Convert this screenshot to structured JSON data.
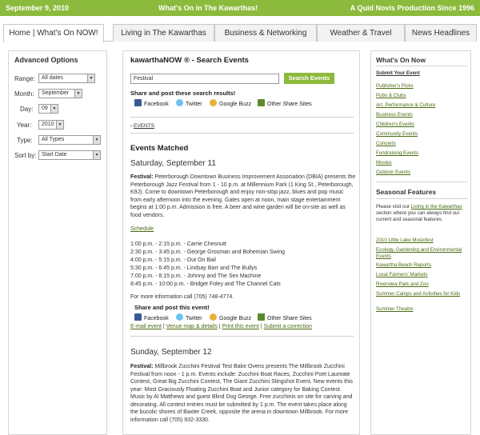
{
  "topbar": {
    "date": "September 9, 2010",
    "tagline": "What's On in The Kawarthas!",
    "production": "A Quid Novis Production Since 1996"
  },
  "nav": {
    "tabs": [
      {
        "label": "Home | What's On NOW!"
      },
      {
        "label": "Living in The Kawarthas"
      },
      {
        "label": "Business & Networking"
      },
      {
        "label": "Weather & Travel"
      },
      {
        "label": "News Headlines"
      }
    ]
  },
  "options": {
    "title": "Advanced Options",
    "range": {
      "label": "Range:",
      "value": "All dates"
    },
    "month": {
      "label": "Month:",
      "value": "September"
    },
    "day": {
      "label": "Day:",
      "value": "09"
    },
    "year": {
      "label": "Year:",
      "value": "2010"
    },
    "type": {
      "label": "Type:",
      "value": "All Types"
    },
    "sort": {
      "label": "Sort by:",
      "value": "Start Date"
    }
  },
  "search": {
    "title": "kawarthaNOW ® - Search Events",
    "query": "Festival",
    "button": "Search Events",
    "share_prompt": "Share and post these search results!",
    "share": {
      "facebook": "Facebook",
      "twitter": "Twitter",
      "buzz": "Google Buzz",
      "other": "Other Share Sites"
    },
    "breadcrumb": "EVENTS",
    "matched": "Events Matched"
  },
  "event1": {
    "date": "Saturday, September 11",
    "prefix": "Festival:",
    "description": " Peterborough Downtown Business Improvement Association (DBIA) presents the Peterborough Jazz Festival from 1 - 10 p.m. at Millennium Park (1 King St., Peterborough, K9J). Come to downtown Peterborough and enjoy non-stop jazz, blues and pop music from early afternoon into the evening. Gates open at noon, main stage entertainment begins at 1:00 p.m. Admission is free. A beer and wine garden will be on-site as well as food vendors.",
    "schedule_link": "Schedule",
    "schedule": [
      "1:00 p.m. - 2:15 p.m. - Carrie Chesnutt",
      "2:30 p.m. - 3:45 p.m. - George Grosman and Bohemian Swing",
      "4:00 p.m. - 5:15 p.m. - Out On Bail",
      "5:30 p.m. - 6:45 p.m. - Lindsay Barr and The Bullys",
      "7:00 p.m. - 8:15 p.m. - Johnny and The Sex Machine",
      "8:45 p.m. - 10:00 p.m. - Bridget Foley and The Channel Cats"
    ],
    "info": "For more information call (705) 748-4774.",
    "share_prompt": "Share and post this event!",
    "share": {
      "facebook": "Facebook",
      "twitter": "Twitter",
      "buzz": "Google Buzz",
      "other": "Other Share Sites"
    },
    "actions": {
      "email": "E-mail event",
      "venue": "Venue map & details",
      "print": "Print this event",
      "correction": "Submit a correction"
    }
  },
  "event2": {
    "date": "Sunday, September 12",
    "prefix": "Festival:",
    "description": " Millbrook Zucchini Festival Test Bake Ovens presents The Millbrook Zucchini Festival from noon - 1 p.m. Events include: Zucchini Boat Races, Zucchini Poet Laureate Contest, Great Big Zucchini Contest, The Giant Zucchini Slingshot Event. New events this year: Most Graciously Floating Zucchini Boat and Junior category for Baking Contest. Music by Al Matthews and guest Blind Dog George. Free zucchinis on site for carving and decorating. All contest entries must be submitted by 1 p.m. The event takes place along the bucolic shores of Baxter Creek, opposite the arena in downtown Millbrook. For more information call (705) 932-3330."
  },
  "sidebar": {
    "whats_on_title": "What's On Now",
    "submit": "Submit Your Event",
    "categories": [
      "Publisher's Picks",
      "Pubs & Clubs",
      "Art, Performance & Culture",
      "Business Events",
      "Children's Events",
      "Community Events",
      "Concerts",
      "Fundraising Events",
      "Movies",
      "Outdoor Events"
    ],
    "seasonal_title": "Seasonal Features",
    "seasonal_pre": "Please visit our ",
    "seasonal_link": "Living in the Kawarthas",
    "seasonal_post": " section where you can always find our current and seasonal features.",
    "features": [
      "2010 Little Lake Musicfest",
      "Ecology, Gardening and Environmental Events",
      "Kawartha Beach Reports",
      "Local Farmers' Markets",
      "Riverview Park and Zoo",
      "Summer Camps and Activities for Kids",
      "Summer Theatre"
    ]
  },
  "colors": {
    "brand_green": "#8cba3c",
    "link_green": "#4a6a10"
  }
}
